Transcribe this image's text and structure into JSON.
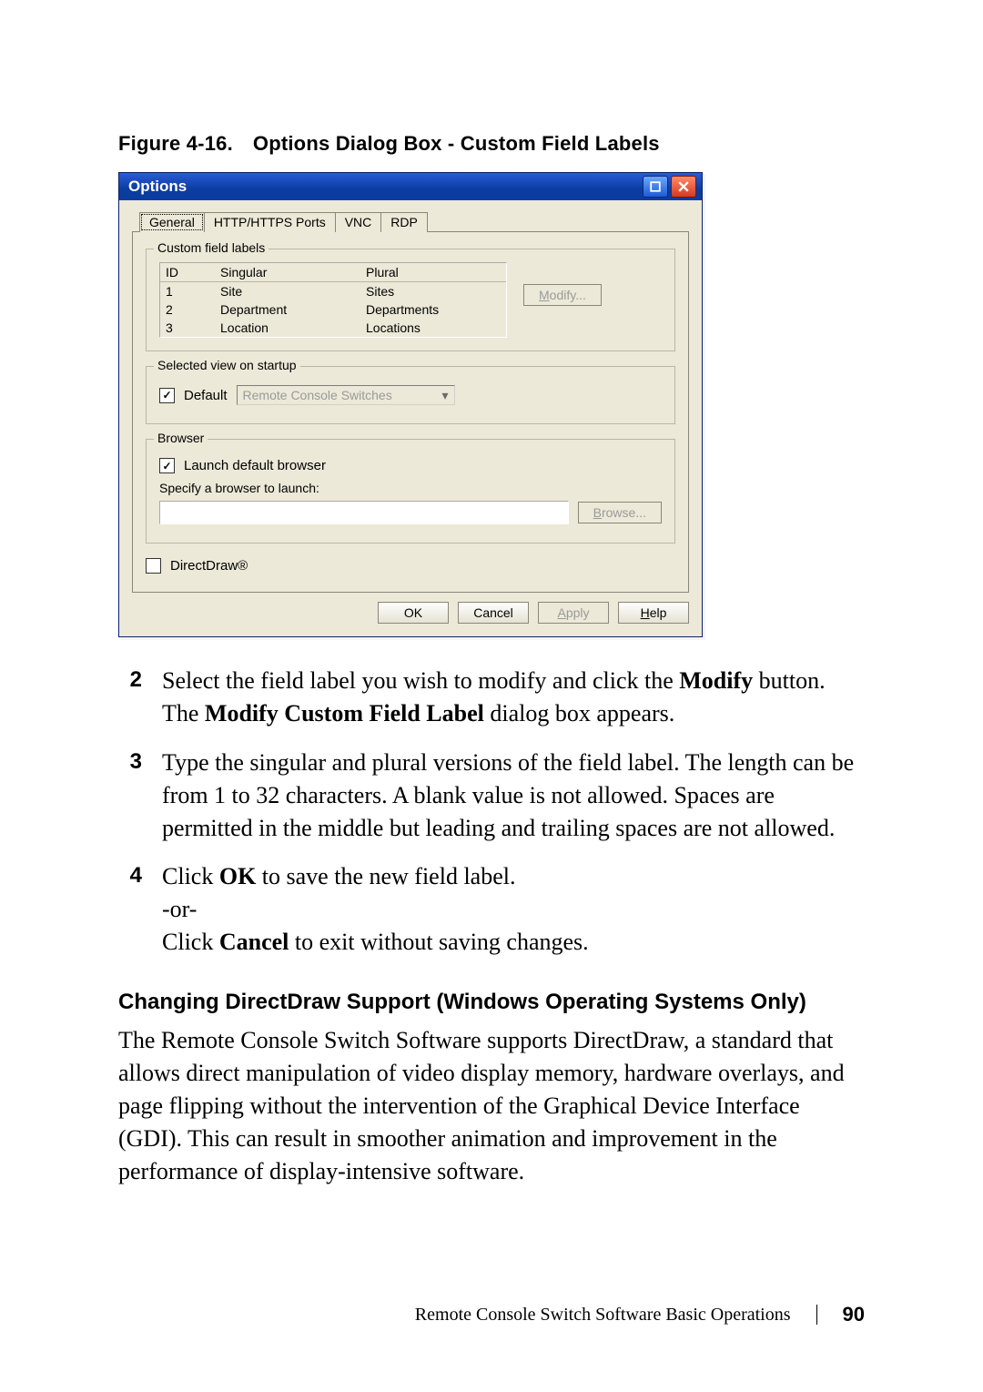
{
  "figure": {
    "label": "Figure 4-16.",
    "title": "Options Dialog Box - Custom Field Labels"
  },
  "dialog": {
    "title": "Options",
    "tabs": [
      "General",
      "HTTP/HTTPS Ports",
      "VNC",
      "RDP"
    ],
    "group_custom": {
      "legend": "Custom field labels",
      "headers": {
        "id": "ID",
        "singular": "Singular",
        "plural": "Plural"
      },
      "rows": [
        {
          "id": "1",
          "singular": "Site",
          "plural": "Sites"
        },
        {
          "id": "2",
          "singular": "Department",
          "plural": "Departments"
        },
        {
          "id": "3",
          "singular": "Location",
          "plural": "Locations"
        }
      ],
      "modify": "Modify..."
    },
    "group_view": {
      "legend": "Selected view on startup",
      "default_label": "Default",
      "select_value": "Remote Console Switches"
    },
    "group_browser": {
      "legend": "Browser",
      "launch_label": "Launch default browser",
      "specify_label": "Specify a browser to launch:",
      "browse": "Browse..."
    },
    "directdraw_label": "DirectDraw®",
    "buttons": {
      "ok": "OK",
      "cancel": "Cancel",
      "apply": "Apply",
      "help": "Help"
    }
  },
  "steps": [
    {
      "num": "2",
      "parts": [
        "Select the field label you wish to modify and click the ",
        "Modify",
        " button. The ",
        "Modify Custom Field Label",
        " dialog box appears."
      ]
    },
    {
      "num": "3",
      "text": "Type the singular and plural versions of the field label. The length can be from 1 to 32 characters. A blank value is not allowed. Spaces are permitted in the middle but leading and trailing spaces are not allowed."
    },
    {
      "num": "4",
      "parts": [
        "Click ",
        "OK",
        " to save the new field label.",
        "-or-",
        "Click ",
        "Cancel",
        " to exit without saving changes."
      ]
    }
  ],
  "section": {
    "heading": "Changing DirectDraw Support (Windows Operating Systems Only)",
    "para": "The Remote Console Switch Software supports DirectDraw, a standard that allows direct manipulation of video display memory, hardware overlays, and page flipping without the intervention of the Graphical Device Interface (GDI). This can result in smoother animation and improvement in the performance of display-intensive software."
  },
  "footer": {
    "running": "Remote Console Switch Software Basic Operations",
    "page": "90"
  }
}
